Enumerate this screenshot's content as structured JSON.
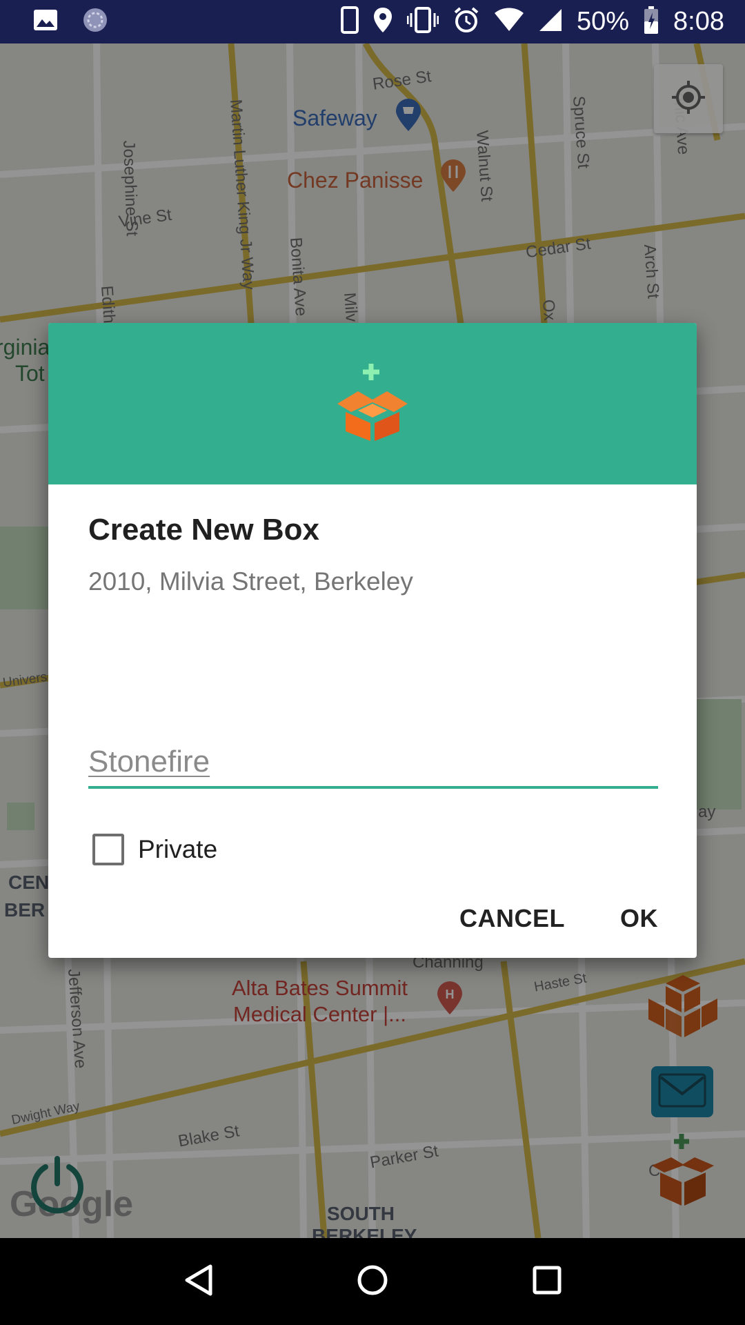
{
  "status_bar": {
    "battery": "50%",
    "time": "8:08",
    "icons": [
      "image-icon",
      "sync-icon",
      "phone-icon",
      "location-icon",
      "vibrate-icon",
      "alarm-icon",
      "wifi-icon",
      "signal-icon",
      "battery-icon"
    ]
  },
  "map": {
    "streets": [
      "Rose St",
      "Josephine St",
      "Martin Luther King Jr Way",
      "Walnut St",
      "Spruce St",
      "Vine St",
      "Cedar St",
      "Arch St",
      "Bonita Ave",
      "Edith",
      "Milv",
      "Ox",
      "Jefferson Ave",
      "Dwight Way",
      "Blake St",
      "Parker St",
      "Haste St",
      "Channing",
      "Univers",
      "enic Ave",
      "ay",
      "C"
    ],
    "pois": {
      "safeway": "Safeway",
      "chez_panisse": "Chez Panisse",
      "alta_bates_line1": "Alta Bates Summit",
      "alta_bates_line2": "Medical Center |..."
    },
    "districts": {
      "central_berkeley_1": "CEN",
      "central_berkeley_2": "BER",
      "south_berkeley_1": "SOUTH",
      "south_berkeley_2": "BERKELEY",
      "virginia_1": "rginia",
      "virginia_2": "Tot"
    },
    "google_logo": "Google"
  },
  "dialog": {
    "title": "Create New Box",
    "address": "2010, Milvia Street, Berkeley",
    "name_value": "Stonefire",
    "private_label": "Private",
    "private_checked": false,
    "cancel_label": "CANCEL",
    "ok_label": "OK",
    "header_color": "#33ae8f",
    "accent_color": "#33ae8f"
  },
  "fabs": [
    "boxes-icon",
    "mail-icon",
    "add-box-icon"
  ],
  "nav": [
    "back-icon",
    "home-icon",
    "recents-icon"
  ]
}
